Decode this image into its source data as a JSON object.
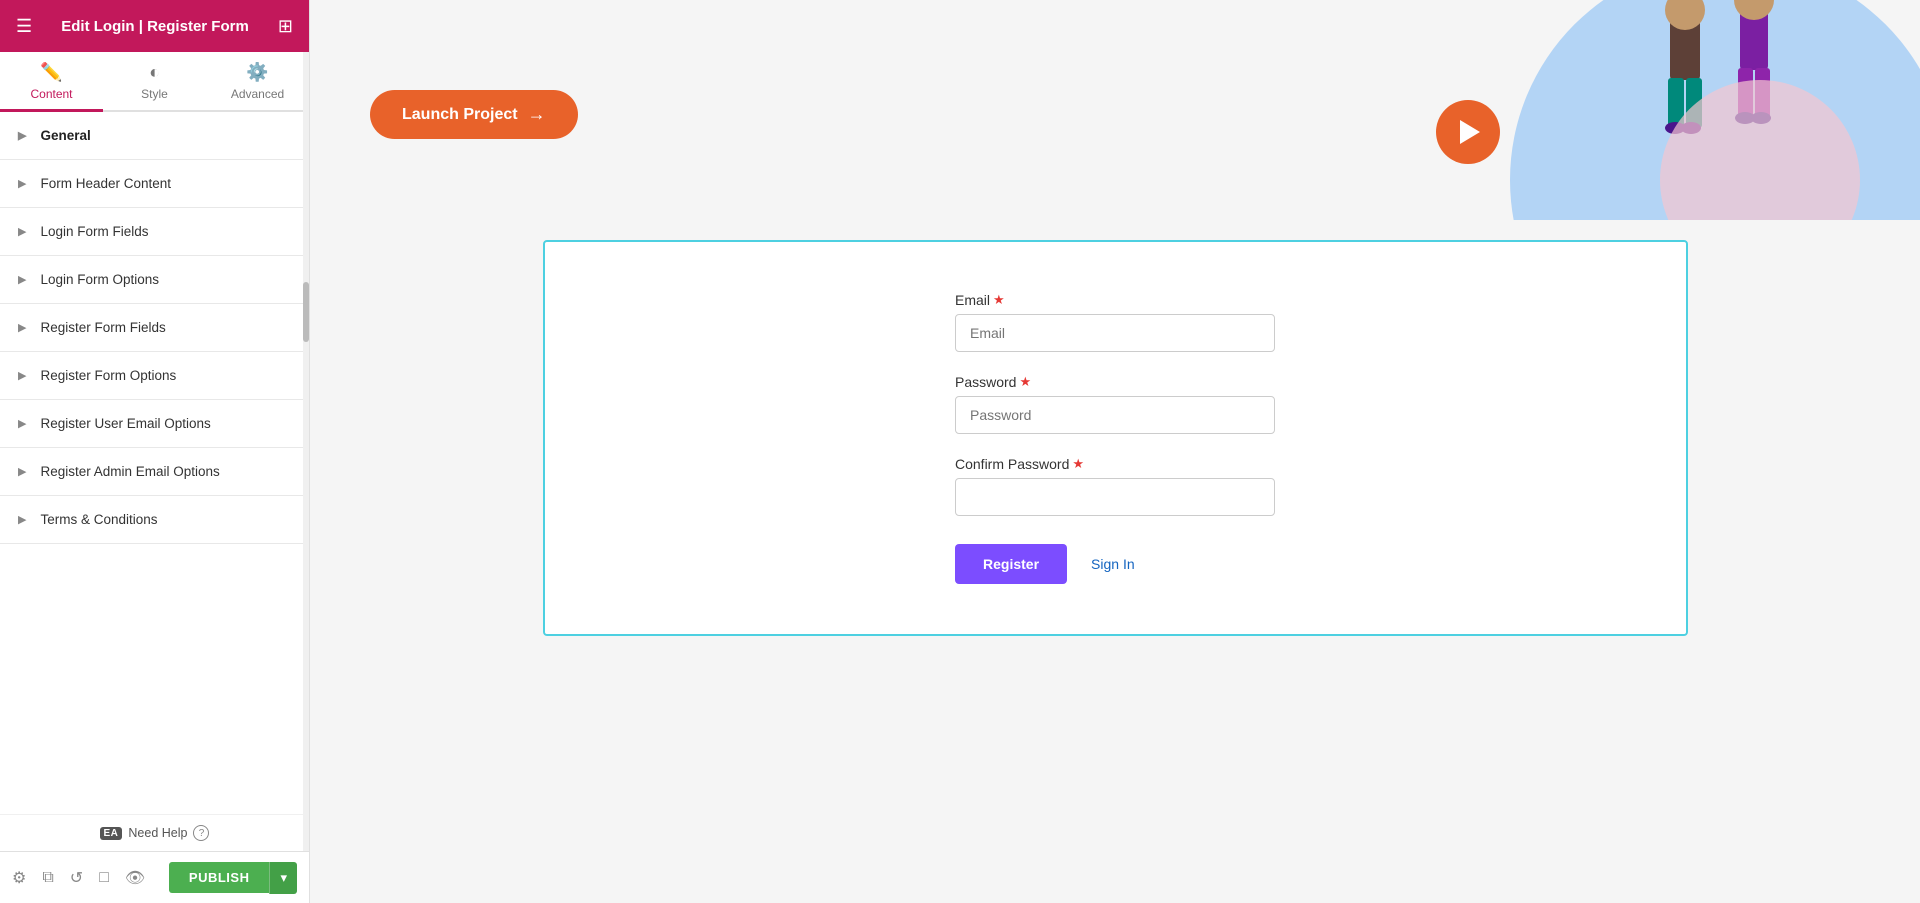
{
  "topbar": {
    "title": "Edit Login | Register Form",
    "hamburger": "☰",
    "grid": "⊞"
  },
  "tabs": [
    {
      "id": "content",
      "label": "Content",
      "icon": "✏️",
      "active": true
    },
    {
      "id": "style",
      "label": "Style",
      "icon": "◐",
      "active": false
    },
    {
      "id": "advanced",
      "label": "Advanced",
      "icon": "⚙️",
      "active": false
    }
  ],
  "accordion": {
    "items": [
      {
        "id": "general",
        "label": "General"
      },
      {
        "id": "form-header-content",
        "label": "Form Header Content"
      },
      {
        "id": "login-form-fields",
        "label": "Login Form Fields"
      },
      {
        "id": "login-form-options",
        "label": "Login Form Options"
      },
      {
        "id": "register-form-fields",
        "label": "Register Form Fields"
      },
      {
        "id": "register-form-options",
        "label": "Register Form Options"
      },
      {
        "id": "register-user-email-options",
        "label": "Register User Email Options"
      },
      {
        "id": "register-admin-email-options",
        "label": "Register Admin Email Options"
      },
      {
        "id": "terms-conditions",
        "label": "Terms & Conditions"
      }
    ]
  },
  "need_help": {
    "ea_label": "EA",
    "text": "Need Help",
    "icon": "?"
  },
  "bottom_bar": {
    "icons": [
      "⚙",
      "⧉",
      "↺",
      "□",
      "👁"
    ],
    "publish_label": "PUBLISH",
    "publish_arrow": "▾"
  },
  "launch_button": {
    "label": "Launch Project",
    "arrow": "→"
  },
  "form": {
    "fields": [
      {
        "id": "email",
        "label": "Email",
        "placeholder": "Email",
        "required": true,
        "type": "text"
      },
      {
        "id": "password",
        "label": "Password",
        "placeholder": "Password",
        "required": true,
        "type": "password"
      },
      {
        "id": "confirm-password",
        "label": "Confirm Password",
        "placeholder": "",
        "required": true,
        "type": "password"
      }
    ],
    "register_button": "Register",
    "signin_link": "Sign In"
  }
}
